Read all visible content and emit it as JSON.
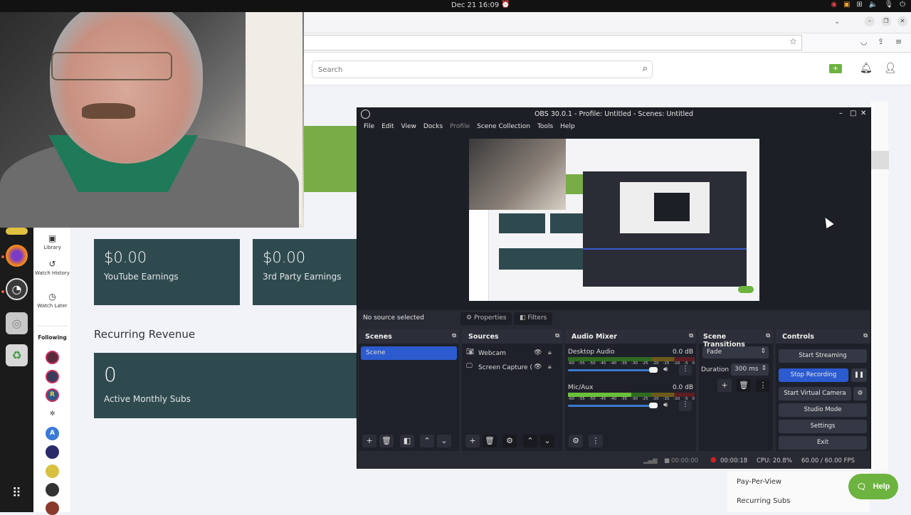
{
  "topbar": {
    "datetime": "Dec 21  16:09",
    "tray_icons": [
      "obs-recording-icon",
      "screen-share-icon",
      "network-icon",
      "volume-icon",
      "mic-icon",
      "power-icon"
    ]
  },
  "browser": {
    "search_placeholder": "Search",
    "header_icons": [
      "create-video-icon",
      "notifications-icon",
      "account-icon"
    ]
  },
  "dock": {
    "apps": [
      {
        "name": "files",
        "active": false
      },
      {
        "name": "firefox",
        "active": true
      },
      {
        "name": "obs-studio",
        "active": true
      },
      {
        "name": "disk",
        "active": false
      },
      {
        "name": "trash",
        "active": false
      }
    ]
  },
  "yt_sidebar": {
    "nav": [
      {
        "label": "Library",
        "icon": "library-icon"
      },
      {
        "label": "Watch History",
        "icon": "history-icon"
      },
      {
        "label": "Watch Later",
        "icon": "clock-icon"
      }
    ],
    "following_label": "Following",
    "following_count": 9
  },
  "dashboard": {
    "cards": [
      {
        "value": "$0.00",
        "label": "YouTube Earnings"
      },
      {
        "value": "$0.00",
        "label": "3rd Party Earnings"
      }
    ],
    "recurring_title": "Recurring Revenue",
    "recurring_card": {
      "value": "0",
      "label": "Active Monthly Subs"
    },
    "right_menu": [
      "Pay-Per-View",
      "Recurring Subs"
    ],
    "help_label": "Help"
  },
  "obs": {
    "title": "OBS 30.0.1 - Profile: Untitled - Scenes: Untitled",
    "menu": [
      {
        "label": "File",
        "enabled": true
      },
      {
        "label": "Edit",
        "enabled": true
      },
      {
        "label": "View",
        "enabled": true
      },
      {
        "label": "Docks",
        "enabled": true
      },
      {
        "label": "Profile",
        "enabled": false
      },
      {
        "label": "Scene Collection",
        "enabled": true
      },
      {
        "label": "Tools",
        "enabled": true
      },
      {
        "label": "Help",
        "enabled": true
      }
    ],
    "no_source": "No source selected",
    "properties_label": "Properties",
    "filters_label": "Filters",
    "scenes": {
      "title": "Scenes",
      "items": [
        "Scene"
      ],
      "selected": 0
    },
    "sources": {
      "title": "Sources",
      "items": [
        "Webcam",
        "Screen Capture (Pi"
      ]
    },
    "audio": {
      "title": "Audio Mixer",
      "channels": [
        {
          "name": "Desktop Audio",
          "db": "0.0 dB",
          "level": 0.0
        },
        {
          "name": "Mic/Aux",
          "db": "0.0 dB",
          "level": 0.5
        }
      ],
      "ticks": [
        "-60",
        "-55",
        "-50",
        "-45",
        "-40",
        "-35",
        "-30",
        "-25",
        "-20",
        "-15",
        "-10",
        "-5",
        "0"
      ]
    },
    "transitions": {
      "title": "Scene Transitions",
      "type": "Fade",
      "duration_label": "Duration",
      "duration": "300 ms"
    },
    "controls": {
      "title": "Controls",
      "start_streaming": "Start Streaming",
      "stop_recording": "Stop Recording",
      "virtual_camera": "Start Virtual Camera",
      "studio_mode": "Studio Mode",
      "settings": "Settings",
      "exit": "Exit"
    },
    "status": {
      "stream_time": "00:00:00",
      "rec_time": "00:00:18",
      "cpu": "CPU: 20.8%",
      "fps": "60.00 / 60.00 FPS"
    },
    "accent": "#2c5bd0"
  }
}
